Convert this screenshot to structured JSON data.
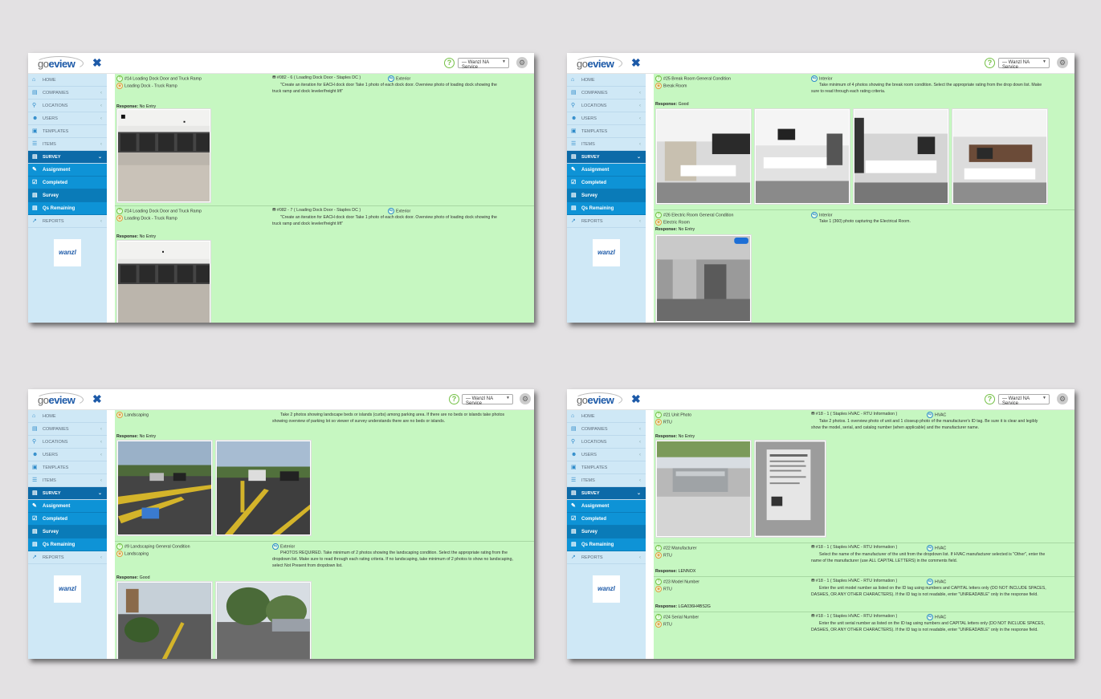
{
  "app": {
    "logo_go": "go",
    "logo_name": "eview",
    "company_select": "— Wanzl NA Service",
    "help_glyph": "?",
    "close_glyph": "✖",
    "brand_logo": "wanzl"
  },
  "nav": [
    {
      "label": "HOME",
      "icon": "home-icon"
    },
    {
      "label": "COMPANIES",
      "icon": "building-icon"
    },
    {
      "label": "LOCATIONS",
      "icon": "map-pin-icon"
    },
    {
      "label": "USERS",
      "icon": "users-icon"
    },
    {
      "label": "TEMPLATES",
      "icon": "template-icon"
    },
    {
      "label": "ITEMS",
      "icon": "list-icon"
    },
    {
      "label": "SURVEY",
      "icon": "survey-icon"
    },
    {
      "label": "Assignment",
      "icon": "edit-icon"
    },
    {
      "label": "Completed",
      "icon": "check-icon"
    },
    {
      "label": "Survey",
      "icon": "survey-icon"
    },
    {
      "label": "Qs Remaining",
      "icon": "survey-icon"
    },
    {
      "label": "REPORTS",
      "icon": "chart-icon"
    }
  ],
  "screens": [
    {
      "cards": [
        {
          "question": "#14 Loading Dock Door and Truck Ramp",
          "area": "Loading Dock - Truck Ramp",
          "asset": "#082 - 6 ( Loading Dock Door - Staples DC )",
          "location": "Exterior",
          "instruction": "\"Create an iteration for EACH dock door Take 1 photo of each dock door. Overview photo of loading dock showing the truck ramp and dock leveler/freight lift\"",
          "response_label": "Response:",
          "response_value": "No Entry"
        },
        {
          "question": "#14 Loading Dock Door and Truck Ramp",
          "area": "Loading Dock - Truck Ramp",
          "asset": "#082 - 7 ( Loading Dock Door - Staples DC )",
          "location": "Exterior",
          "instruction": "\"Create an iteration for EACH dock door Take 1 photo of each dock door. Overview photo of loading dock showing the truck ramp and dock leveler/freight lift\"",
          "response_label": "Response:",
          "response_value": "No Entry"
        }
      ]
    },
    {
      "cards": [
        {
          "question": "#25 Break Room General Condition",
          "area": "Break Room",
          "location": "Interior",
          "instruction": "Take minimum of 4 photos showing the break room condition. Select the appropriate rating from the drop down list. Make sure to read through each rating criteria.",
          "response_label": "Response:",
          "response_value": "Good"
        },
        {
          "question": "#26 Electric Room General Condition",
          "area": "Electric Room",
          "location": "Interior",
          "instruction": "Take 1 (360) photo capturing the Electrical Room.",
          "response_label": "Response:",
          "response_value": "No Entry"
        }
      ]
    },
    {
      "cards": [
        {
          "area": "Landscaping",
          "instruction": "Take 2 photos showing landscape beds or islands (curbs) among parking area. If there are no beds or islands take photos showing overview of parking lot so viewer of survey understands there are no beds or islands.",
          "response_label": "Response:",
          "response_value": "No Entry"
        },
        {
          "question": "#9 Landscaping General Condition",
          "area": "Landscaping",
          "location": "Exterior",
          "instruction": "PHOTOS REQUIRED. Take minimum of 2 photos showing the landscaping condition. Select the appropriate rating from the dropdown list. Make sure to read through each rating criteria. If no landscaping, take minimum of 2 photos to show no landscaping, select Not Present from dropdown list.",
          "response_label": "Response:",
          "response_value": "Good"
        }
      ]
    },
    {
      "cards": [
        {
          "question": "#21 Unit Photo",
          "area": "RTU",
          "asset": "#18 - 1 ( Staples HVAC - RTU Information )",
          "location": "HVAC",
          "instruction": "Take 2 photos. 1 overview photo of unit and 1 closeup photo of the manufacturer's ID tag. Be sure it is clear and legibly show the model, serial, and catalog number (when applicable) and the manufacturer name.",
          "response_label": "Response:",
          "response_value": "No Entry"
        },
        {
          "question": "#22 Manufacturer",
          "area": "RTU",
          "asset": "#18 - 1 ( Staples HVAC - RTU Information )",
          "location": "HVAC",
          "instruction": "Select the name of the manufacturer of the unit from the dropdown list. If HVAC manufacturer selected is \"Other\", enter the name of the manufacturer (use ALL CAPITAL LETTERS) in the comments field.",
          "response_label": "Response:",
          "response_value": "LENNOX"
        },
        {
          "question": "#23 Model Number",
          "area": "RTU",
          "asset": "#18 - 1 ( Staples HVAC - RTU Information )",
          "location": "HVAC",
          "instruction": "Enter the unit model number as listed on the ID tag using numbers and CAPITAL letters only (DO NOT INCLUDE SPACES, DASHES, OR ANY OTHER CHARACTERS). If the ID tag is not readable, enter \"UNREADABLE\" only in the response field.",
          "response_label": "Response:",
          "response_value": "LGA036H4BS2G"
        },
        {
          "question": "#24 Serial Number",
          "area": "RTU",
          "asset": "#18 - 1 ( Staples HVAC - RTU Information )",
          "location": "HVAC",
          "instruction": "Enter the unit serial number as listed on the ID tag using numbers and CAPITAL letters only (DO NOT INCLUDE SPACES, DASHES, OR ANY OTHER CHARACTERS). If the ID tag is not readable, enter \"UNREADABLE\" only in the response field."
        }
      ]
    }
  ],
  "colors": {
    "content_bg": "#c6f7c1",
    "sidebar_bg": "#cfe8f6",
    "nav_active": "#0c6aa8",
    "nav_sub": "#0e93d6",
    "brand_blue": "#1d5aa8",
    "help_green": "#74c046"
  }
}
